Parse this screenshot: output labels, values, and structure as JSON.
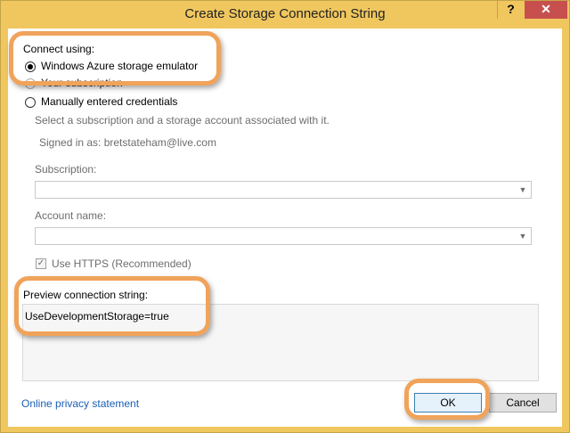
{
  "window": {
    "title": "Create Storage Connection String",
    "help_glyph": "?",
    "close_glyph": "✕"
  },
  "connect": {
    "label": "Connect using:",
    "options": [
      {
        "label": "Windows Azure storage emulator",
        "selected": true
      },
      {
        "label": "Your subscription",
        "selected": false
      },
      {
        "label": "Manually entered credentials",
        "selected": false
      }
    ]
  },
  "subscription_section": {
    "hint": "Select a subscription and a storage account associated with it.",
    "signed_in": "Signed in as: bretstateham@live.com",
    "subscription_label": "Subscription:",
    "subscription_value": "",
    "account_label": "Account name:",
    "account_value": "",
    "https_label": "Use HTTPS (Recommended)",
    "https_checked": true
  },
  "preview": {
    "label": "Preview connection string:",
    "value": "UseDevelopmentStorage=true"
  },
  "footer": {
    "privacy_link": "Online privacy statement",
    "ok_label": "OK",
    "cancel_label": "Cancel"
  },
  "colors": {
    "title_bar": "#f0c75e",
    "close_button": "#c7504e",
    "callout": "#f0a35a",
    "link": "#1a5fb4"
  }
}
